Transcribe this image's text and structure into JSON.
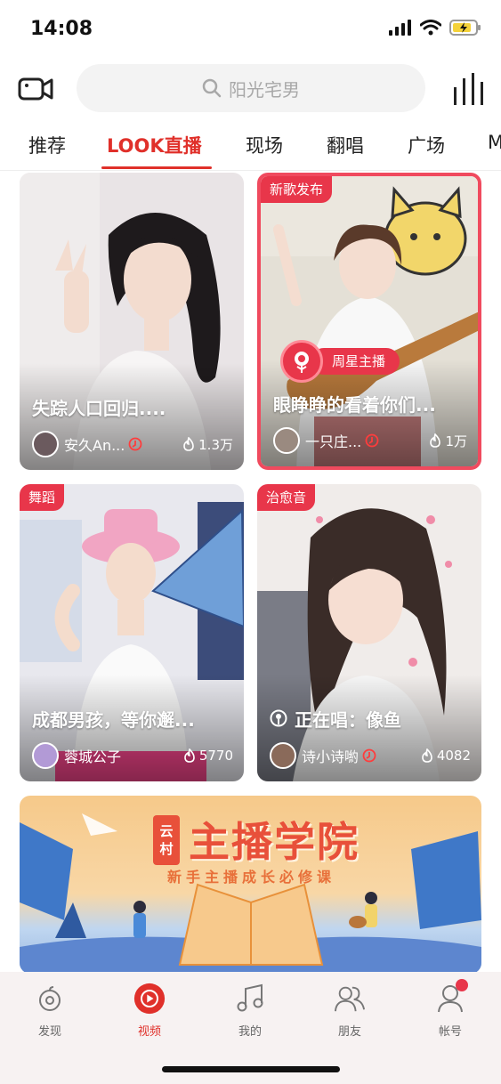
{
  "status_bar": {
    "time": "14:08"
  },
  "search": {
    "placeholder": "阳光宅男"
  },
  "tabs": [
    {
      "label": "推荐"
    },
    {
      "label": "LOOK直播"
    },
    {
      "label": "现场"
    },
    {
      "label": "翻唱"
    },
    {
      "label": "广场"
    },
    {
      "label": "M"
    }
  ],
  "cards": [
    {
      "tag": "",
      "title": "失踪人口回归....",
      "author": "安久An...",
      "heat": "1.3万"
    },
    {
      "tag": "新歌发布",
      "badge": "周星主播",
      "title": "眼睁睁的看着你们...",
      "author": "一只庄...",
      "heat": "1万"
    },
    {
      "tag": "舞蹈",
      "title": "成都男孩，等你邂...",
      "author": "蓉城公子",
      "heat": "5770"
    },
    {
      "tag": "治愈音",
      "title": "正在唱：像鱼",
      "author": "诗小诗喲",
      "heat": "4082"
    }
  ],
  "banner": {
    "tag_line1": "云",
    "tag_line2": "村",
    "title": "主播学院",
    "subtitle": "新手主播成长必修课"
  },
  "bottom_nav": [
    {
      "label": "发现",
      "icon": "discover-icon"
    },
    {
      "label": "视频",
      "icon": "video-icon"
    },
    {
      "label": "我的",
      "icon": "music-note-icon"
    },
    {
      "label": "朋友",
      "icon": "friends-icon"
    },
    {
      "label": "帐号",
      "icon": "account-icon"
    }
  ],
  "colors": {
    "accent": "#e0302a",
    "tag": "#e8364a"
  }
}
